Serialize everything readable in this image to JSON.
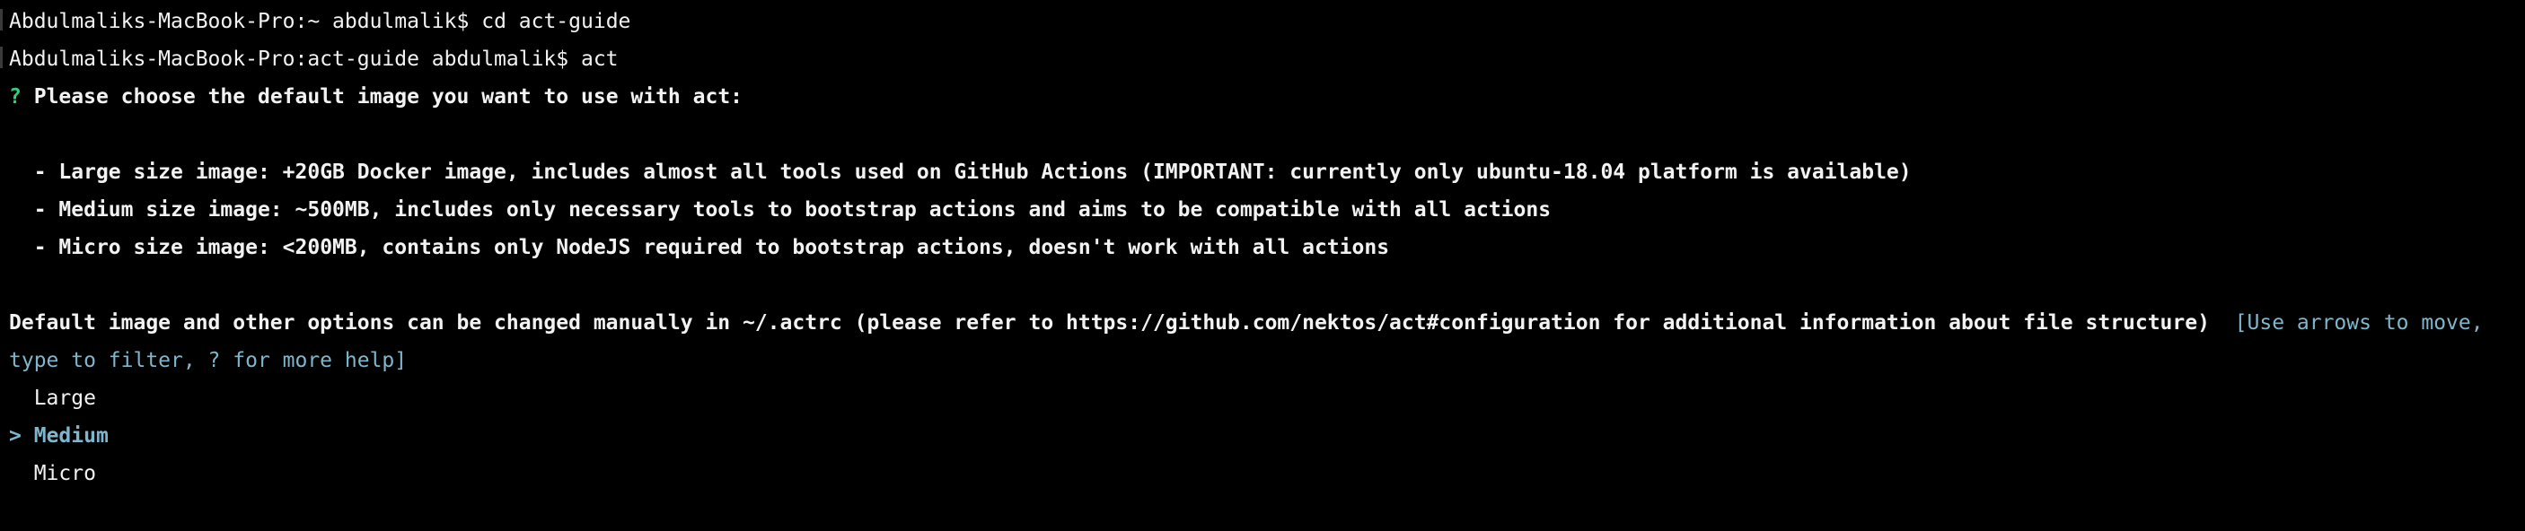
{
  "terminal": {
    "history": [
      {
        "prompt": "Abdulmaliks-MacBook-Pro:~ abdulmalik$",
        "command": "cd act-guide"
      },
      {
        "prompt": "Abdulmaliks-MacBook-Pro:act-guide abdulmalik$",
        "command": "act"
      }
    ],
    "question": {
      "mark": "?",
      "text": "Please choose the default image you want to use with act:"
    },
    "descriptions": [
      "- Large size image: +20GB Docker image, includes almost all tools used on GitHub Actions (IMPORTANT: currently only ubuntu-18.04 platform is available)",
      "- Medium size image: ~500MB, includes only necessary tools to bootstrap actions and aims to be compatible with all actions",
      "- Micro size image: <200MB, contains only NodeJS required to bootstrap actions, doesn't work with all actions"
    ],
    "note": "Default image and other options can be changed manually in ~/.actrc (please refer to https://github.com/nektos/act#configuration for additional information about file structure)",
    "hint_line1": "[Use arrows to move,",
    "hint_line2": "type to filter, ? for more help]",
    "options": [
      "Large",
      "Medium",
      "Micro"
    ],
    "selected_index": 1,
    "selection_marker": ">"
  },
  "colors": {
    "background": "#000000",
    "text": "#f2f2f2",
    "question_mark": "#33d17a",
    "hint": "#7fb6cc",
    "selected": "#7fb6cc"
  }
}
